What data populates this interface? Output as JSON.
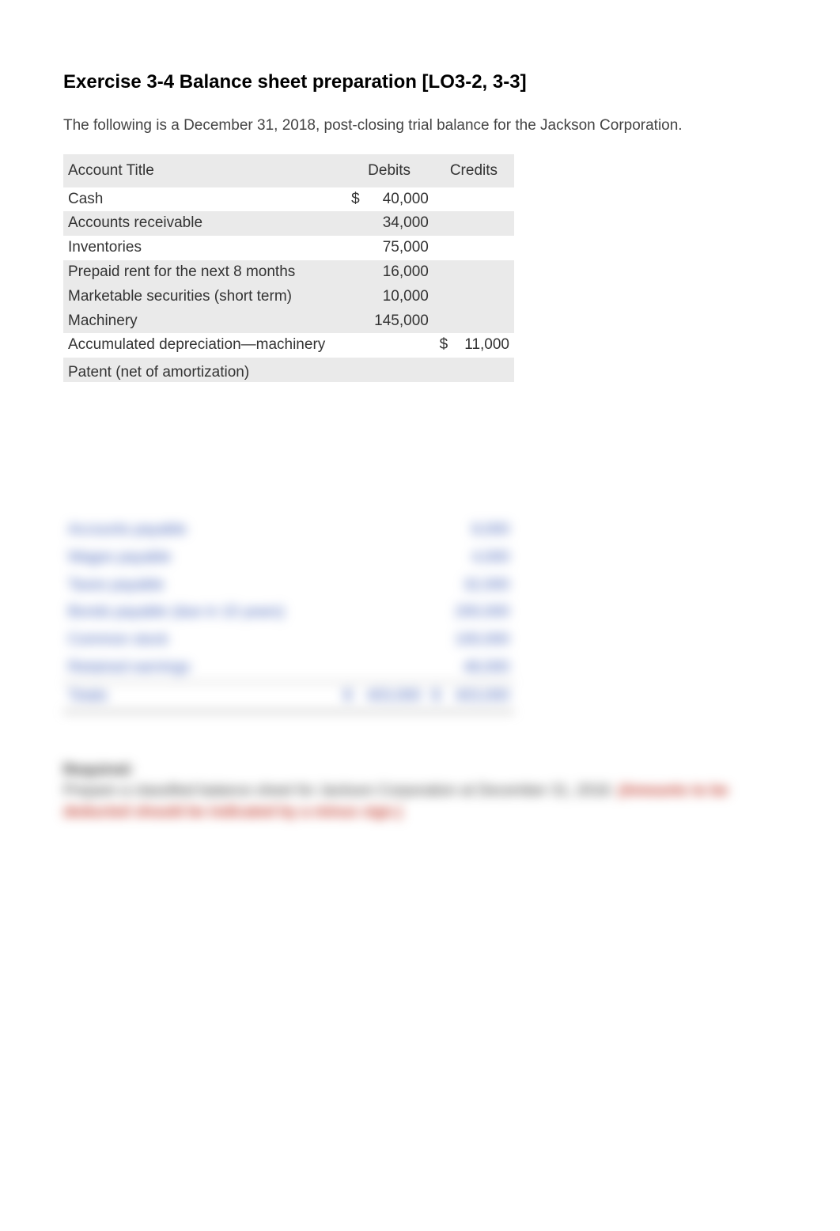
{
  "title": "Exercise 3-4 Balance sheet preparation [LO3-2, 3-3]",
  "intro": "The following is a December 31, 2018, post-closing trial balance for the Jackson Corporation.",
  "headers": {
    "account": "Account Title",
    "debits": "Debits",
    "credits": "Credits"
  },
  "rows": [
    {
      "class": "odd",
      "title": "Cash",
      "debit_cur": "$",
      "debit": "40,000",
      "credit_cur": "",
      "credit": ""
    },
    {
      "class": "even",
      "title": "Accounts receivable",
      "debit_cur": "",
      "debit": "34,000",
      "credit_cur": "",
      "credit": ""
    },
    {
      "class": "odd",
      "title": "Inventories",
      "debit_cur": "",
      "debit": "75,000",
      "credit_cur": "",
      "credit": ""
    },
    {
      "class": "even",
      "title": "Prepaid rent for the next 8 months",
      "debit_cur": "",
      "debit": "16,000",
      "credit_cur": "",
      "credit": ""
    },
    {
      "class": "even",
      "title": "Marketable securities (short term)",
      "debit_cur": "",
      "debit": "10,000",
      "credit_cur": "",
      "credit": ""
    },
    {
      "class": "even",
      "title": "Machinery",
      "debit_cur": "",
      "debit": "145,000",
      "credit_cur": "",
      "credit": ""
    },
    {
      "class": "odd",
      "title": "Accumulated depreciation—machinery",
      "debit_cur": "",
      "debit": "",
      "credit_cur": "$",
      "credit": "11,000"
    }
  ],
  "cutoff_row": {
    "title": "Patent (net of amortization)"
  },
  "blurred": {
    "rows": [
      {
        "title": "Accounts payable",
        "credit": "8,000"
      },
      {
        "title": "Wages payable",
        "credit": "4,000"
      },
      {
        "title": "Taxes payable",
        "credit": "32,000"
      },
      {
        "title": "Bonds payable (due in 10 years)",
        "credit": "200,000"
      },
      {
        "title": "Common stock",
        "credit": "100,000"
      },
      {
        "title": "Retained earnings",
        "credit": "48,000"
      }
    ],
    "totals": {
      "title": "Totals",
      "debit_cur": "$",
      "debit": "403,000",
      "credit_cur": "$",
      "credit": "403,000"
    }
  },
  "required": {
    "heading": "Required:",
    "line1": "Prepare a classified balance sheet for Jackson Corporation at December 31, 2018. ",
    "line2_red": "(Amounts to be deducted should be indicated by a minus sign.)"
  }
}
